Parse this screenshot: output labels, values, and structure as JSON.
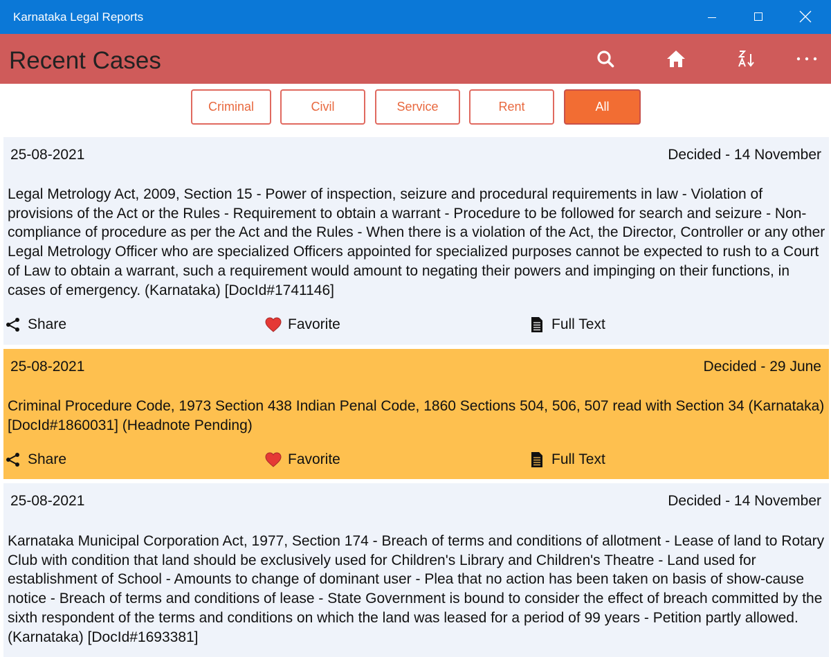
{
  "window": {
    "title": "Karnataka Legal Reports",
    "titlebar_color": "#0b78d7"
  },
  "header": {
    "title": "Recent Cases",
    "color": "#cf5b5a",
    "icons": [
      "search-icon",
      "home-icon",
      "sort-az-icon",
      "more-icon"
    ]
  },
  "filters": [
    {
      "label": "Criminal",
      "active": false
    },
    {
      "label": "Civil",
      "active": false
    },
    {
      "label": "Service",
      "active": false
    },
    {
      "label": "Rent",
      "active": false
    },
    {
      "label": "All",
      "active": true
    }
  ],
  "accent_color": "#f26d33",
  "highlight_color": "#fec04f",
  "cases": [
    {
      "date": "25-08-2021",
      "decided": "Decided - 14 November",
      "headnote": "Legal Metrology Act, 2009, Section 15 - Power of inspection, seizure and procedural requirements in law - Violation of provisions of the Act or the Rules - Requirement to obtain a warrant - Procedure to be followed for search and seizure - Non-compliance of procedure as per the Act and the Rules - When there is a violation of the Act, the Director, Controller or any other Legal Metrology Officer who are specialized Officers appointed for specialized purposes cannot be expected to rush to a Court of Law to obtain a warrant, such a requirement would amount to negating their powers and impinging on their functions, in cases of emergency. (Karnataka) [DocId#1741146]",
      "highlighted": false
    },
    {
      "date": "25-08-2021",
      "decided": "Decided - 29 June",
      "headnote": "Criminal Procedure Code, 1973 Section 438 Indian Penal Code, 1860 Sections 504, 506, 507 read with Section 34  (Karnataka) [DocId#1860031] (Headnote Pending)",
      "highlighted": true
    },
    {
      "date": "25-08-2021",
      "decided": "Decided - 14 November",
      "headnote": "Karnataka Municipal Corporation Act, 1977, Section 174 - Breach of terms and conditions of allotment - Lease of land to Rotary Club with condition that land should be exclusively used for Children's Library and Children's Theatre - Land used for establishment of School - Amounts to change of dominant user - Plea that no action has been taken on basis of show-cause notice - Breach of terms and conditions of lease - State Government is bound to consider the effect of breach committed by the sixth respondent of the terms and conditions on which the land was leased for a period of 99 years - Petition partly allowed. (Karnataka) [DocId#1693381]",
      "highlighted": false
    }
  ],
  "actions": {
    "share": "Share",
    "favorite": "Favorite",
    "full_text": "Full Text"
  }
}
